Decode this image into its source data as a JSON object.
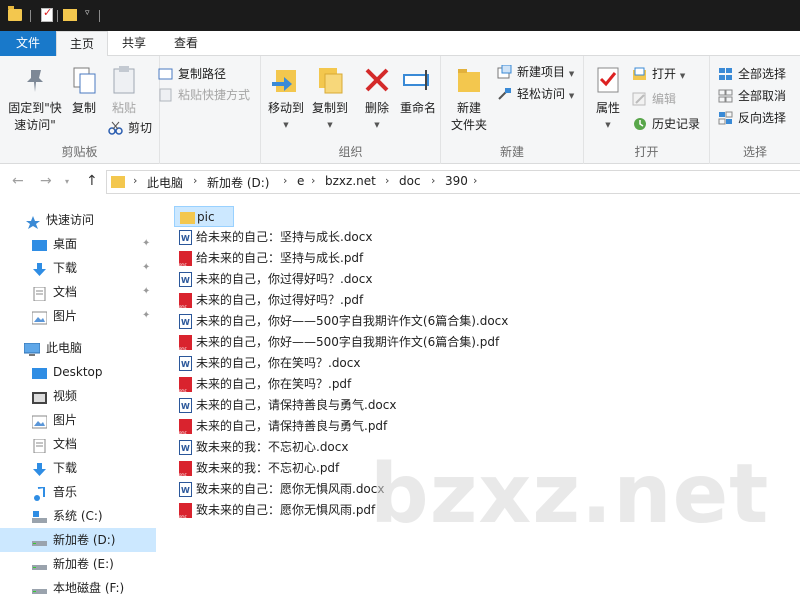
{
  "ribbon_tabs": {
    "file": "文件",
    "home": "主页",
    "share": "共享",
    "view": "查看"
  },
  "clipboard": {
    "pin_label": "固定到\"快速访问\"",
    "copy_label": "复制",
    "paste_label": "粘贴",
    "copy_path": "复制路径",
    "paste_shortcut": "粘贴快捷方式",
    "cut": "剪切",
    "group": "剪贴板"
  },
  "organize": {
    "move_to": "移动到",
    "copy_to": "复制到",
    "delete": "删除",
    "rename": "重命名",
    "group": "组织"
  },
  "new": {
    "new_folder": "新建\n文件夹",
    "new_item": "新建项目",
    "easy_access": "轻松访问",
    "group": "新建"
  },
  "open": {
    "properties": "属性",
    "open": "打开",
    "edit": "编辑",
    "history": "历史记录",
    "group": "打开"
  },
  "select": {
    "select_all": "全部选择",
    "select_none": "全部取消",
    "invert": "反向选择",
    "group": "选择"
  },
  "breadcrumb": [
    "此电脑",
    "新加卷 (D:)",
    "e",
    "bzxz.net",
    "doc",
    "390"
  ],
  "nav": {
    "quick_access": "快速访问",
    "quick_items": [
      "桌面",
      "下载",
      "文档",
      "图片"
    ],
    "this_pc": "此电脑",
    "pc_items": [
      "Desktop",
      "视频",
      "图片",
      "文档",
      "下载",
      "音乐",
      "系统 (C:)",
      "新加卷 (D:)",
      "新加卷 (E:)",
      "本地磁盘 (F:)"
    ]
  },
  "files": [
    {
      "name": "pic",
      "type": "folder"
    },
    {
      "name": "给未来的自己：坚持与成长.docx",
      "type": "docx"
    },
    {
      "name": "给未来的自己：坚持与成长.pdf",
      "type": "pdf"
    },
    {
      "name": "未来的自己，你过得好吗？.docx",
      "type": "docx"
    },
    {
      "name": "未来的自己，你过得好吗？.pdf",
      "type": "pdf"
    },
    {
      "name": "未来的自己，你好——500字自我期许作文(6篇合集).docx",
      "type": "docx"
    },
    {
      "name": "未来的自己，你好——500字自我期许作文(6篇合集).pdf",
      "type": "pdf"
    },
    {
      "name": "未来的自己，你在笑吗？.docx",
      "type": "docx"
    },
    {
      "name": "未来的自己，你在笑吗？.pdf",
      "type": "pdf"
    },
    {
      "name": "未来的自己，请保持善良与勇气.docx",
      "type": "docx"
    },
    {
      "name": "未来的自己，请保持善良与勇气.pdf",
      "type": "pdf"
    },
    {
      "name": "致未来的我：不忘初心.docx",
      "type": "docx"
    },
    {
      "name": "致未来的我：不忘初心.pdf",
      "type": "pdf"
    },
    {
      "name": "致未来的自己：愿你无惧风雨.docx",
      "type": "docx"
    },
    {
      "name": "致未来的自己：愿你无惧风雨.pdf",
      "type": "pdf"
    }
  ],
  "watermark": "bzxz.net",
  "colors": {
    "accent": "#1979ca",
    "selection": "#cce8ff",
    "folder": "#f3c74e",
    "pdf": "#d9232e",
    "word": "#2b579a"
  }
}
